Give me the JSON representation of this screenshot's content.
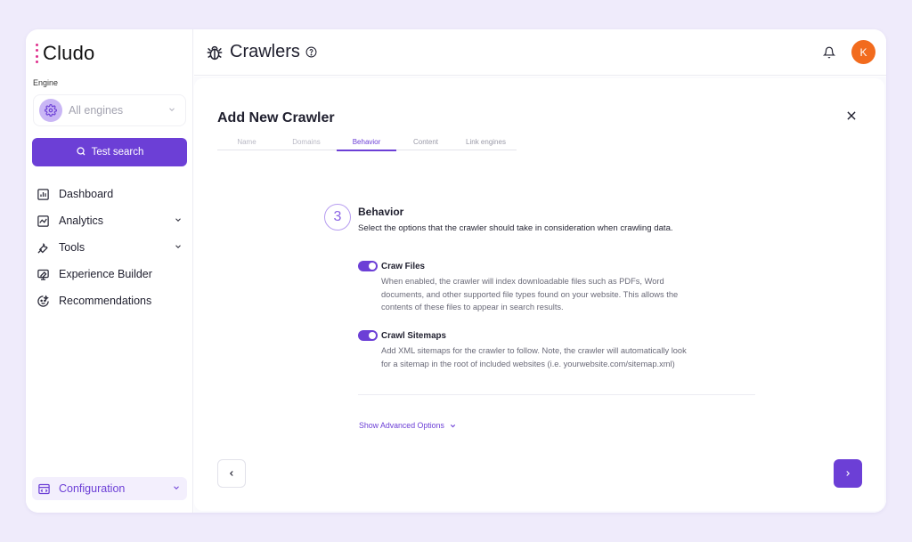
{
  "brand": {
    "name": "Cludo"
  },
  "sidebar": {
    "engine_label": "Engine",
    "engine_value": "All engines",
    "test_search_label": "Test search",
    "items": [
      {
        "label": "Dashboard",
        "icon": "dashboard-icon",
        "has_chevron": false
      },
      {
        "label": "Analytics",
        "icon": "analytics-icon",
        "has_chevron": true
      },
      {
        "label": "Tools",
        "icon": "wrench-icon",
        "has_chevron": true
      },
      {
        "label": "Experience Builder",
        "icon": "experience-builder-icon",
        "has_chevron": false
      },
      {
        "label": "Recommendations",
        "icon": "recommendations-icon",
        "has_chevron": false
      }
    ],
    "configuration_label": "Configuration"
  },
  "header": {
    "title": "Crawlers",
    "avatar_initial": "K"
  },
  "dialog": {
    "title": "Add New Crawler",
    "steps": [
      {
        "label": "Name",
        "state": "done"
      },
      {
        "label": "Domains",
        "state": "done"
      },
      {
        "label": "Behavior",
        "state": "active"
      },
      {
        "label": "Content",
        "state": "pending"
      },
      {
        "label": "Link engines",
        "state": "pending"
      }
    ],
    "step_number": "3",
    "section_title": "Behavior",
    "section_description": "Select the options that the crawler should take in consideration when crawling data.",
    "options": [
      {
        "title": "Craw Files",
        "enabled": true,
        "description_lines": [
          "When enabled, the crawler will index downloadable files such as PDFs, Word",
          "documents, and other supported file types found on your website. This allows the",
          "contents of these files to appear in search results."
        ]
      },
      {
        "title": "Crawl Sitemaps",
        "enabled": true,
        "description_lines": [
          "Add XML sitemaps for the crawler to follow. Note, the crawler will automatically look",
          "for a sitemap in the root of included websites (i.e. yourwebsite.com/sitemap.xml)"
        ]
      }
    ],
    "advanced_label": "Show Advanced Options"
  },
  "colors": {
    "accent": "#6c3fd6",
    "background": "#efebfb",
    "avatar": "#f26b1d",
    "logo_dots": "#e0318e"
  }
}
